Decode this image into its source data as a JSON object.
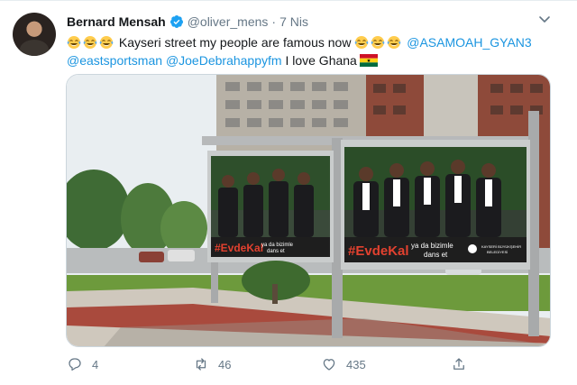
{
  "tweet": {
    "author_name": "Bernard Mensah",
    "handle": "@oliver_mens",
    "separator": "·",
    "date": "7 Nis",
    "text_part1": "Kayseri street my people are famous now",
    "mention1": "@ASAMOAH_GYAN3",
    "mention2": "@eastsportsman",
    "mention3": "@JoeDebrahappyfm",
    "text_part2": "I love Ghana",
    "emoji_name": "face-with-tears-of-joy",
    "flag_name": "ghana-flag"
  },
  "media": {
    "billboard_hashtag": "#EvdeKal",
    "billboard_slogan_1": "ya da bizimle",
    "billboard_slogan_2": "dans et",
    "billboard_small_1": "KAYSERİ BÜYÜKŞEHİR",
    "billboard_small_2": "BELEDİYESİ"
  },
  "actions": {
    "reply_count": "4",
    "retweet_count": "46",
    "like_count": "435"
  },
  "colors": {
    "link": "#1b95e0",
    "muted": "#657786",
    "verified": "#1da1f2"
  }
}
